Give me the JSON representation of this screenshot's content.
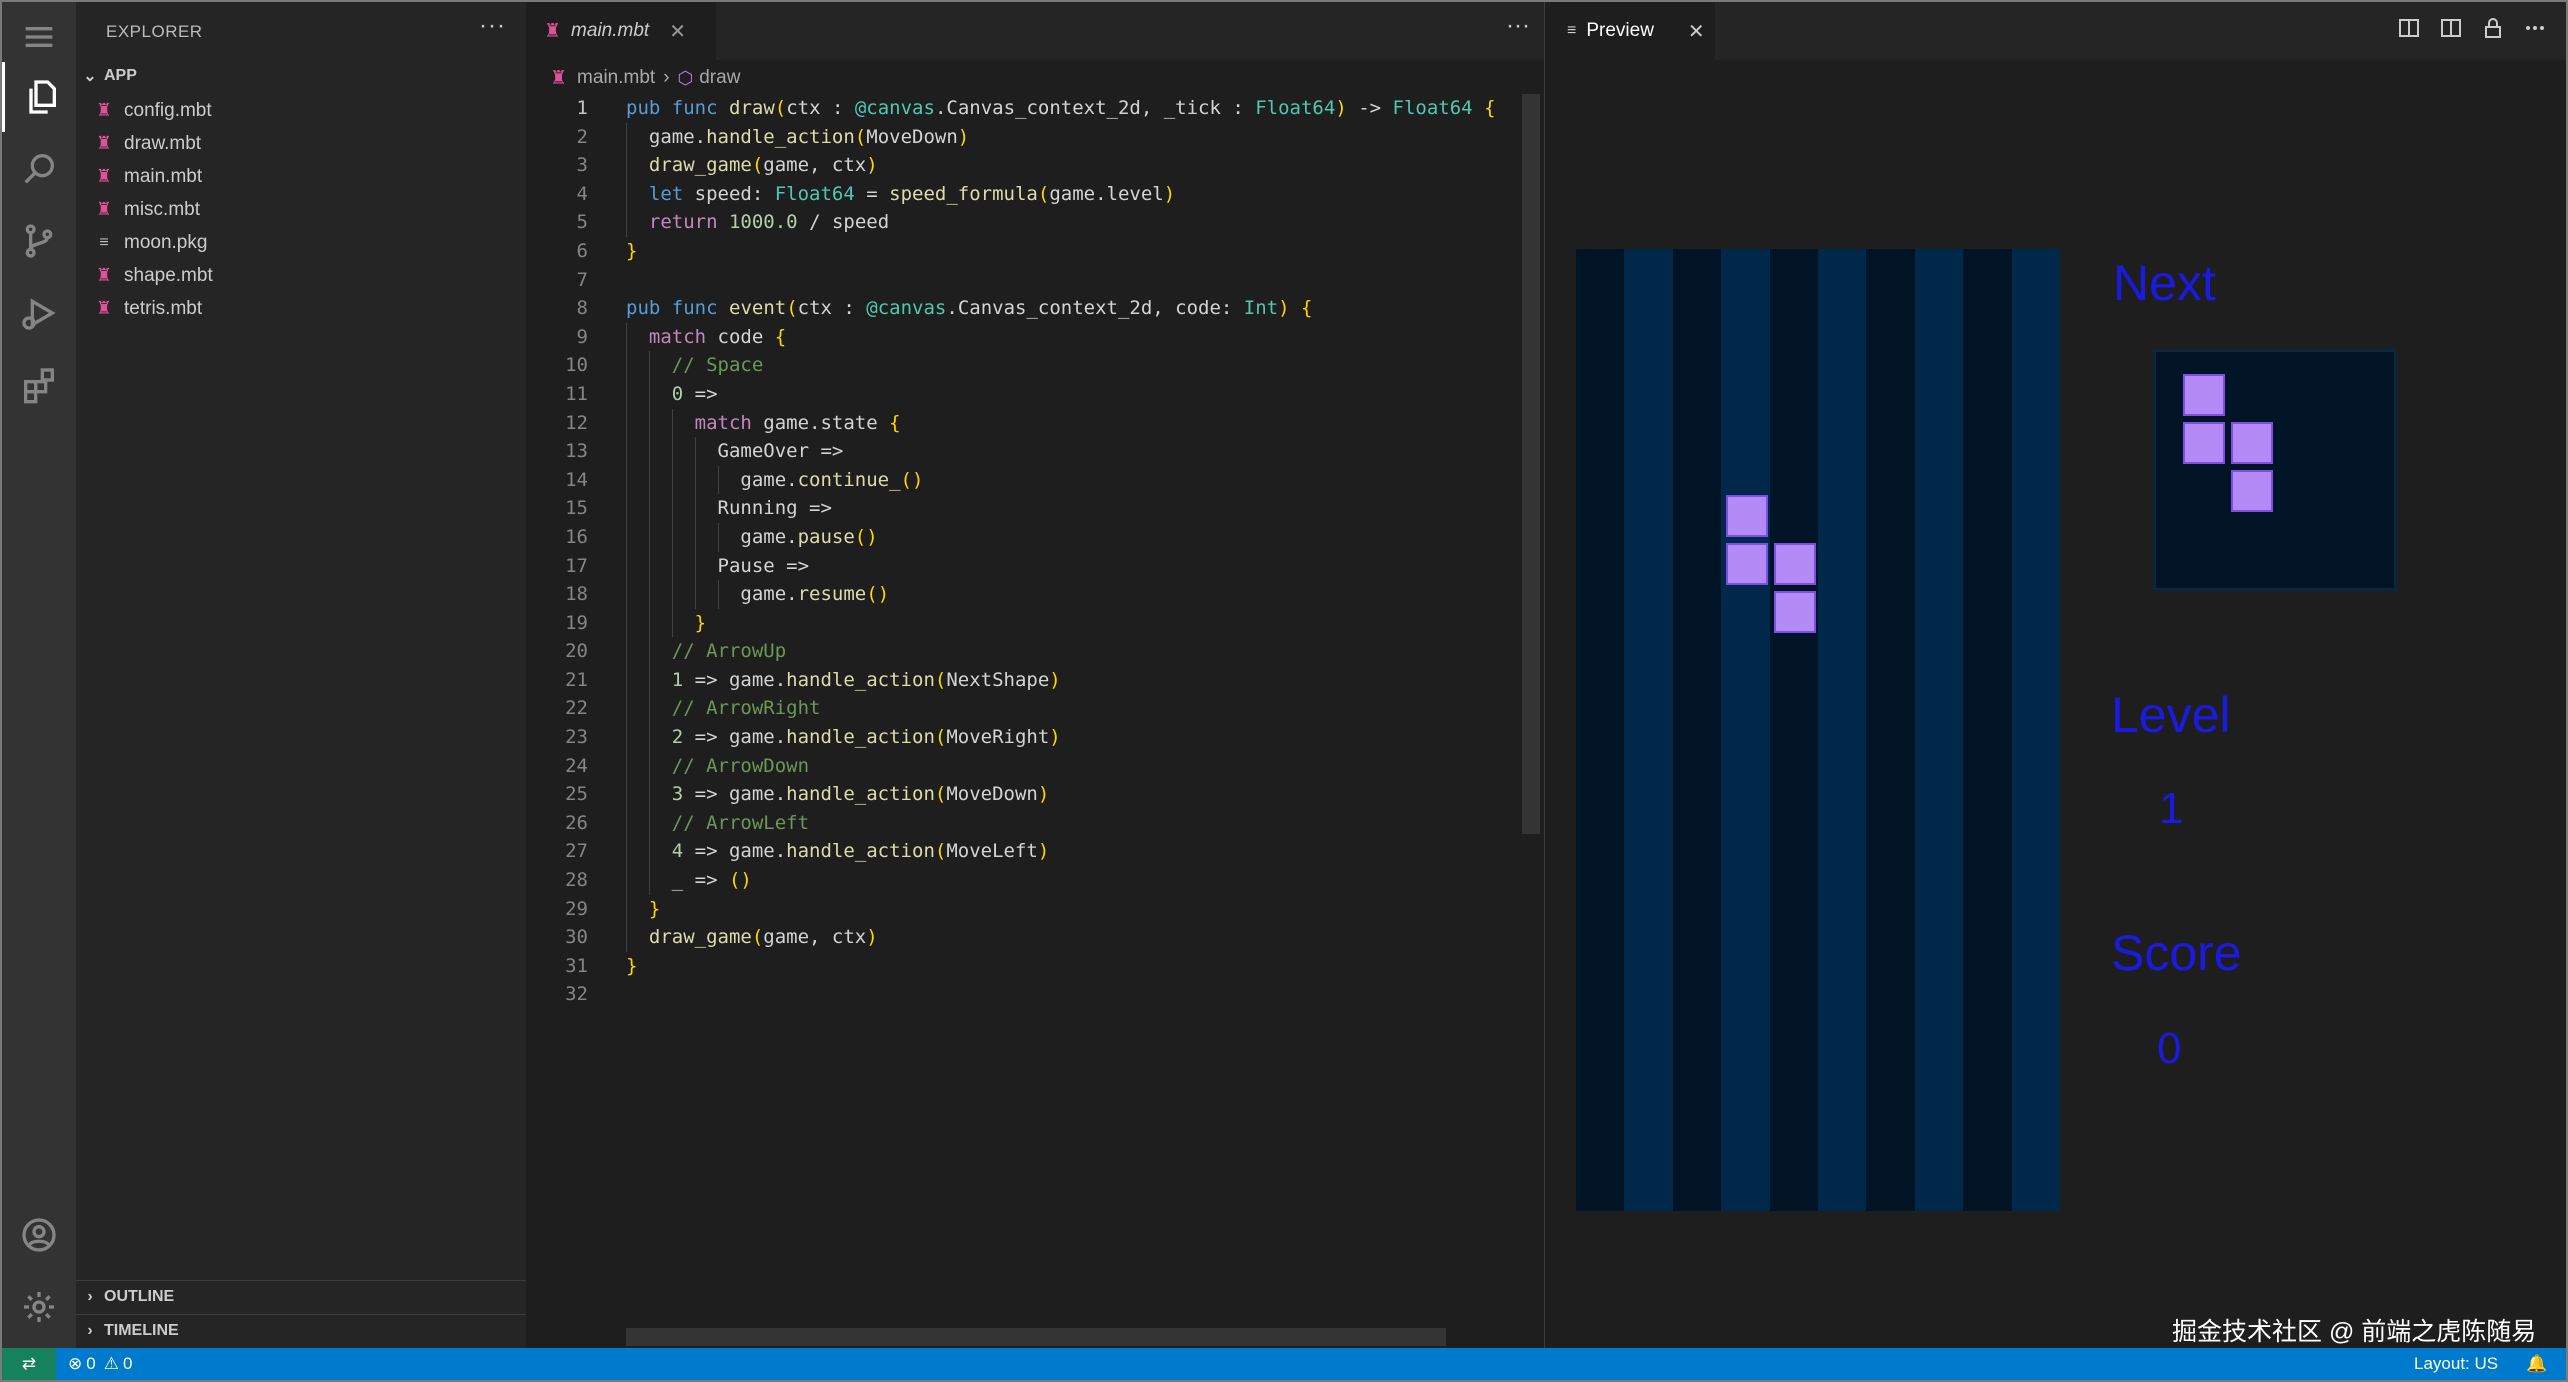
{
  "sidebar": {
    "title": "EXPLORER",
    "more": "···",
    "folder": "APP",
    "files": [
      {
        "name": "config.mbt",
        "icon": "moonbit-file-icon"
      },
      {
        "name": "draw.mbt",
        "icon": "moonbit-file-icon"
      },
      {
        "name": "main.mbt",
        "icon": "moonbit-file-icon"
      },
      {
        "name": "misc.mbt",
        "icon": "moonbit-file-icon"
      },
      {
        "name": "moon.pkg",
        "icon": "list-file-icon"
      },
      {
        "name": "shape.mbt",
        "icon": "moonbit-file-icon"
      },
      {
        "name": "tetris.mbt",
        "icon": "moonbit-file-icon"
      }
    ],
    "outline": "OUTLINE",
    "timeline": "TIMELINE"
  },
  "editor": {
    "tab_label": "main.mbt",
    "more": "···",
    "breadcrumb": {
      "file": "main.mbt",
      "symbol": "draw"
    },
    "current_line": 1,
    "code_lines": [
      "pub func draw(ctx : @canvas.Canvas_context_2d, _tick : Float64) -> Float64 {",
      "  game.handle_action(MoveDown)",
      "  draw_game(game, ctx)",
      "  let speed: Float64 = speed_formula(game.level)",
      "  return 1000.0 / speed",
      "}",
      "",
      "pub func event(ctx : @canvas.Canvas_context_2d, code: Int) {",
      "  match code {",
      "    // Space",
      "    0 =>",
      "      match game.state {",
      "        GameOver =>",
      "          game.continue_()",
      "        Running =>",
      "          game.pause()",
      "        Pause =>",
      "          game.resume()",
      "      }",
      "    // ArrowUp",
      "    1 => game.handle_action(NextShape)",
      "    // ArrowRight",
      "    2 => game.handle_action(MoveRight)",
      "    // ArrowDown",
      "    3 => game.handle_action(MoveDown)",
      "    // ArrowLeft",
      "    4 => game.handle_action(MoveLeft)",
      "    _ => ()",
      "  }",
      "  draw_game(game, ctx)",
      "}",
      ""
    ]
  },
  "preview": {
    "tab_label": "Preview",
    "next_label": "Next",
    "level_label": "Level",
    "level_value": "1",
    "score_label": "Score",
    "score_value": "0",
    "board_columns": 10,
    "board_rows": 20,
    "colors": {
      "piece": "#b48af7",
      "board_dark": "#001426",
      "board_light": "#00284a",
      "text": "#1a1ae0"
    }
  },
  "watermark": "掘金技术社区 @ 前端之虎陈随易",
  "statusbar": {
    "errors": "0",
    "warnings": "0",
    "layout": "Layout: US"
  }
}
